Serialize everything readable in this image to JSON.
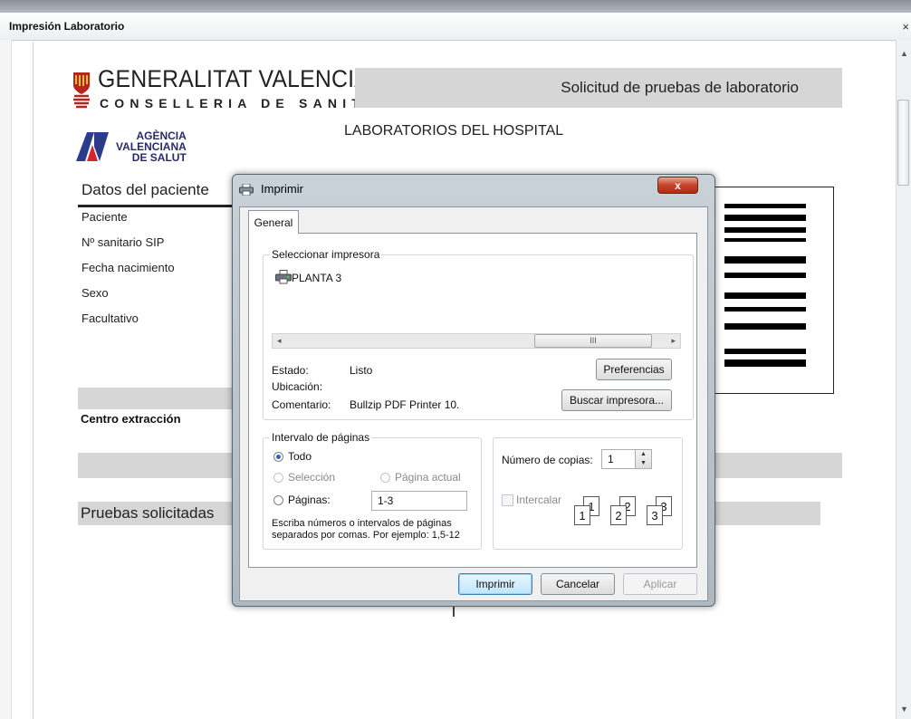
{
  "window": {
    "title": "Impresión Laboratorio",
    "close_glyph": "×"
  },
  "document": {
    "org_name": "GENERALITAT VALENCIANA",
    "org_department": "CONSELLERIA DE SANITAT",
    "request_title": "Solicitud de pruebas de laboratorio",
    "lab_title": "LABORATORIOS DEL HOSPITAL",
    "agency_lines": [
      "AGÈNCIA",
      "VALENCIANA",
      "DE SALUT"
    ],
    "patient_section_title": "Datos del paciente",
    "patient_fields": [
      "Paciente",
      "Nº sanitario SIP",
      "Fecha nacimiento",
      "Sexo",
      "Facultativo"
    ],
    "centro_label": "Centro extracción",
    "pruebas_label": "Pruebas solicitadas"
  },
  "dialog": {
    "title": "Imprimir",
    "close_glyph": "x",
    "tab_general": "General",
    "select_printer_label": "Seleccionar impresora",
    "printer_name": "PLANTA 3",
    "scroll_grip": "III",
    "status_label": "Estado:",
    "status_value": "Listo",
    "location_label": "Ubicación:",
    "comment_label": "Comentario:",
    "comment_value": "Bullzip PDF Printer 10.",
    "preferences_button": "Preferencias",
    "find_printer_button": "Buscar impresora...",
    "page_range_label": "Intervalo de páginas",
    "range_all": "Todo",
    "range_selection": "Selección",
    "range_current_page": "Página actual",
    "range_pages": "Páginas:",
    "pages_value": "1-3",
    "pages_hint": "Escriba números o intervalos de páginas separados por comas. Por ejemplo: 1,5-12",
    "copies_label": "Número de copias:",
    "copies_value": "1",
    "collate_label": "Intercalar",
    "collate_pages": [
      "1",
      "1",
      "2",
      "2",
      "3",
      "3"
    ],
    "print_button": "Imprimir",
    "cancel_button": "Cancelar",
    "apply_button": "Aplicar"
  },
  "icons": [
    "printer-icon",
    "close-icon",
    "radio-selected",
    "spinner-arrows",
    "collate-pages-icon",
    "scroll-arrows"
  ]
}
